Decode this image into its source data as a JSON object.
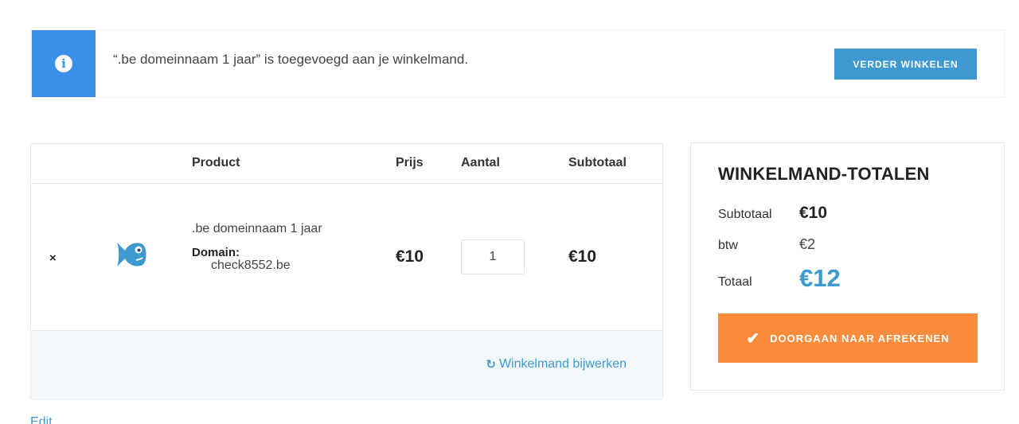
{
  "notice": {
    "icon": "info-icon",
    "message": "“.be domeinnaam 1 jaar” is toegevoegd aan je winkelmand.",
    "continue_label": "VERDER WINKELEN"
  },
  "cart": {
    "columns": {
      "product": "Product",
      "price": "Prijs",
      "quantity": "Aantal",
      "subtotal": "Subtotaal"
    },
    "items": [
      {
        "remove_symbol": "×",
        "thumbnail_icon": "fish-logo-icon",
        "name": ".be domeinnaam 1 jaar",
        "meta_label": "Domain:",
        "meta_value": "check8552.be",
        "price": "€10",
        "quantity": "1",
        "subtotal": "€10"
      }
    ],
    "update_label": "Winkelmand bijwerken",
    "update_icon": "refresh-icon"
  },
  "edit_label": "Edit",
  "totals": {
    "title": "WINKELMAND-TOTALEN",
    "subtotal_label": "Subtotaal",
    "subtotal_value": "€10",
    "tax_label": "btw",
    "tax_value": "€2",
    "total_label": "Totaal",
    "total_value": "€12",
    "checkout_label": "DOORGAAN NAAR AFREKENEN",
    "checkout_icon": "checkmark-icon"
  },
  "colors": {
    "info_blue": "#3b8fe6",
    "accent_blue": "#3d99d0",
    "checkout_orange": "#fb8c3b",
    "footer_bg": "#f1f7fa"
  }
}
